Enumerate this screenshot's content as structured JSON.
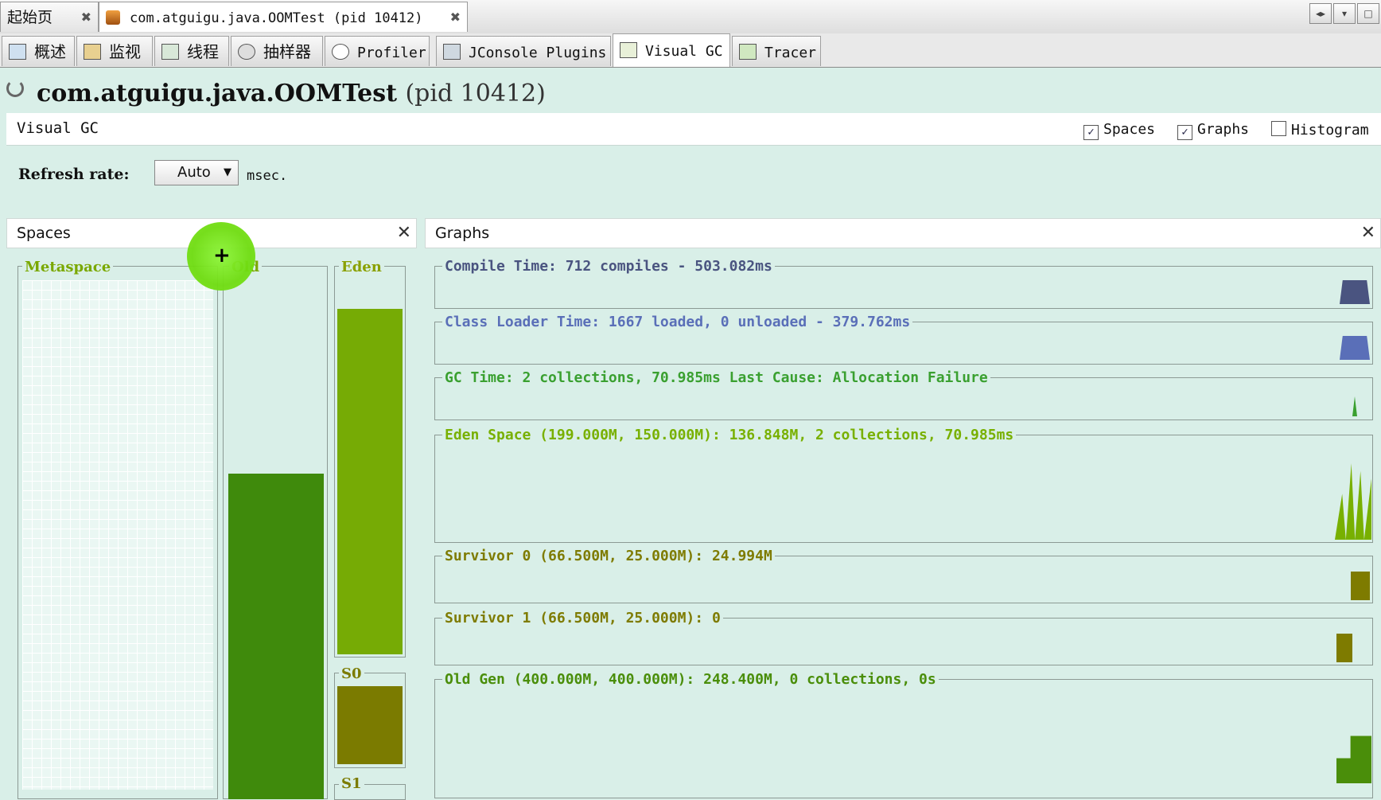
{
  "doc_tabs": [
    {
      "label": "起始页"
    },
    {
      "label": "com.atguigu.java.OOMTest (pid 10412)"
    }
  ],
  "tool_tabs": [
    {
      "label": "概述",
      "icon": "overview-icon"
    },
    {
      "label": "监视",
      "icon": "monitor-icon"
    },
    {
      "label": "线程",
      "icon": "threads-icon"
    },
    {
      "label": "抽样器",
      "icon": "sampler-icon"
    },
    {
      "label": "Profiler",
      "icon": "profiler-clock-icon"
    },
    {
      "label": "JConsole Plugins",
      "icon": "jconsole-icon"
    },
    {
      "label": "Visual GC",
      "icon": "visual-gc-icon"
    },
    {
      "label": "Tracer",
      "icon": "tracer-icon"
    }
  ],
  "app": {
    "name": "com.atguigu.java.OOMTest",
    "pid": "(pid 10412)"
  },
  "visual_gc": {
    "label": "Visual GC",
    "options": [
      {
        "label": "Spaces",
        "checked": true
      },
      {
        "label": "Graphs",
        "checked": true
      },
      {
        "label": "Histogram",
        "checked": false
      }
    ]
  },
  "refresh": {
    "label": "Refresh rate:",
    "value": "Auto",
    "unit": "msec."
  },
  "spaces": {
    "title": "Spaces",
    "metaspace": {
      "label": "Metaspace",
      "fill": 0.0
    },
    "old": {
      "label": "Old",
      "fill": 0.62
    },
    "eden": {
      "label": "Eden",
      "fill": 0.92
    },
    "s0": {
      "label": "S0",
      "fill": 1.0
    },
    "s1": {
      "label": "S1"
    }
  },
  "graphs": {
    "title": "Graphs",
    "items": [
      {
        "label": "Compile Time: 712 compiles - 503.082ms",
        "color": "#4a5480"
      },
      {
        "label": "Class Loader Time: 1667 loaded, 0 unloaded - 379.762ms",
        "color": "#5a6fb8"
      },
      {
        "label": "GC Time: 2 collections, 70.985ms Last Cause: Allocation Failure",
        "color": "#3aa030"
      },
      {
        "label": "Eden Space (199.000M, 150.000M): 136.848M, 2 collections, 70.985ms",
        "color": "#78b000"
      },
      {
        "label": "Survivor 0 (66.500M, 25.000M): 24.994M",
        "color": "#7e7b00"
      },
      {
        "label": "Survivor 1 (66.500M, 25.000M): 0",
        "color": "#7e7b00"
      },
      {
        "label": "Old Gen (400.000M, 400.000M): 248.400M, 0 collections, 0s",
        "color": "#4a8e0a"
      }
    ]
  },
  "colors": {
    "old": "#3f8a0c",
    "eden": "#76ab05",
    "s0": "#7b7b00",
    "background": "#d9efe8"
  }
}
